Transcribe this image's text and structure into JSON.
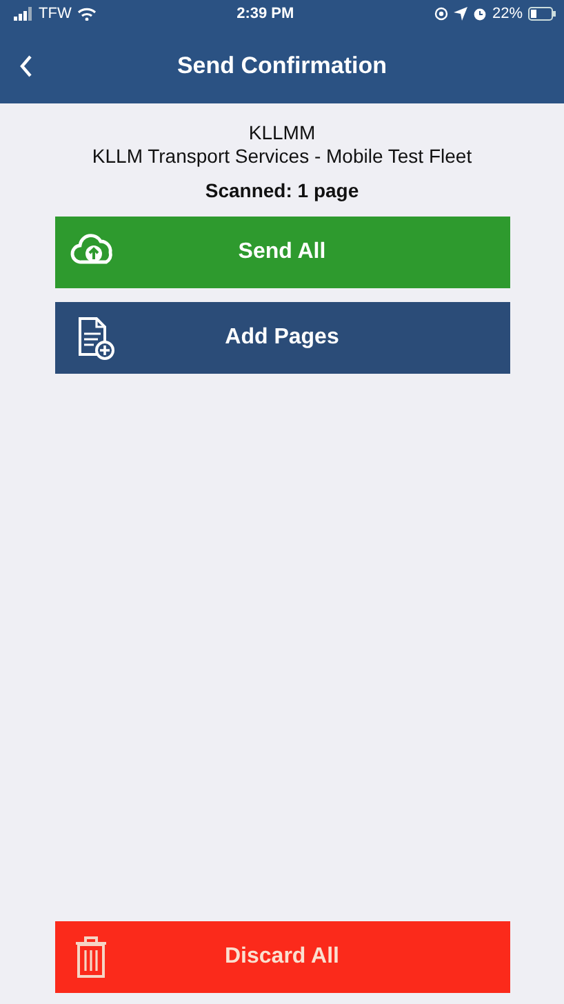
{
  "status_bar": {
    "carrier": "TFW",
    "time": "2:39 PM",
    "battery": "22%"
  },
  "nav": {
    "title": "Send Confirmation"
  },
  "header": {
    "code": "KLLMM",
    "company": "KLLM Transport Services - Mobile Test Fleet",
    "scanned": "Scanned: 1 page"
  },
  "actions": [
    {
      "kind": "send",
      "label": "Send All"
    },
    {
      "kind": "add",
      "label": "Add Pages"
    }
  ],
  "footer_action": {
    "kind": "discard",
    "label": "Discard All"
  }
}
